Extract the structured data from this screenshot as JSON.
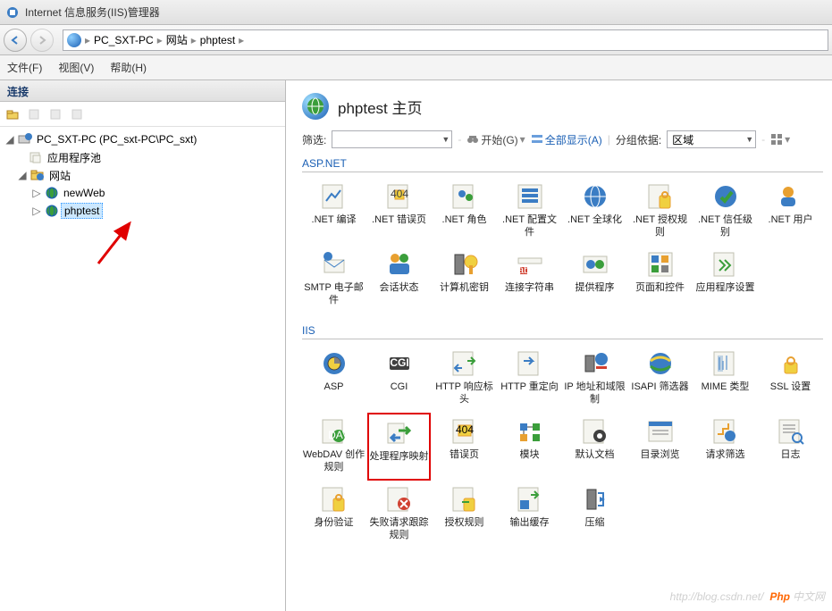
{
  "window": {
    "title": "Internet 信息服务(IIS)管理器"
  },
  "breadcrumb": {
    "root": "PC_SXT-PC",
    "site": "网站",
    "app": "phptest"
  },
  "menu": {
    "file": "文件(F)",
    "view": "视图(V)",
    "help": "帮助(H)"
  },
  "sidebar": {
    "header": "连接",
    "nodes": {
      "server": "PC_SXT-PC (PC_sxt-PC\\PC_sxt)",
      "apppool": "应用程序池",
      "sites": "网站",
      "newweb": "newWeb",
      "phptest": "phptest"
    }
  },
  "mainTitle": "phptest 主页",
  "filter": {
    "label": "筛选:",
    "go": "开始(G)",
    "showAll": "全部显示(A)",
    "groupBy": "分组依据:",
    "groupValue": "区域"
  },
  "groups": {
    "aspnet": "ASP.NET",
    "iis": "IIS"
  },
  "items": {
    "aspnet": [
      ".NET 编译",
      ".NET 错误页",
      ".NET 角色",
      ".NET 配置文件",
      ".NET 全球化",
      ".NET 授权规则",
      ".NET 信任级别",
      ".NET 用户",
      "SMTP 电子邮件",
      "会话状态",
      "计算机密钥",
      "连接字符串",
      "提供程序",
      "页面和控件",
      "应用程序设置"
    ],
    "iis": [
      "ASP",
      "CGI",
      "HTTP 响应标头",
      "HTTP 重定向",
      "IP 地址和域限制",
      "ISAPI 筛选器",
      "MIME 类型",
      "SSL 设置",
      "WebDAV 创作规则",
      "处理程序映射",
      "错误页",
      "模块",
      "默认文档",
      "目录浏览",
      "请求筛选",
      "日志",
      "身份验证",
      "失败请求跟踪规则",
      "授权规则",
      "输出缓存",
      "压缩"
    ]
  },
  "watermark": {
    "url": "http://blog.csdn.net/",
    "brand1": "Php",
    "brand2": "中文网"
  },
  "highlightIndex": 9,
  "iconColors": {
    "page": "#f5f5f0",
    "pageBorder": "#c0c0b0",
    "blue": "#3b7dc4",
    "green": "#3b9e3b",
    "orange": "#e8a030",
    "red": "#d04030",
    "yellow": "#f0d040",
    "gray": "#808080",
    "dark": "#404040"
  }
}
